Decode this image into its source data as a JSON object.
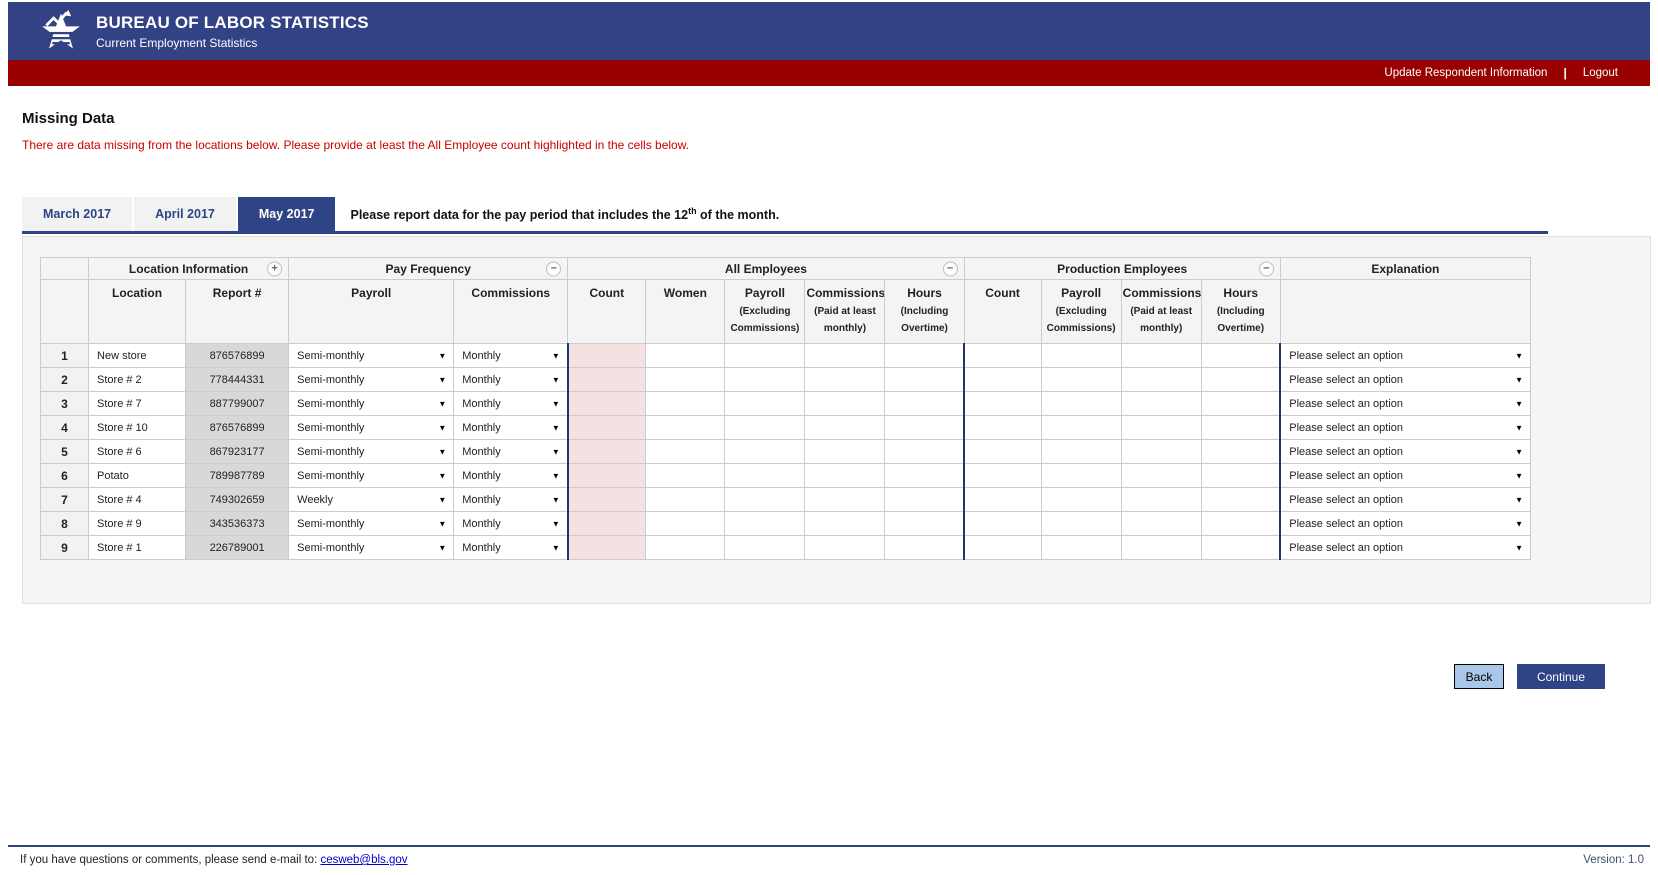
{
  "app": {
    "title": "BUREAU OF LABOR STATISTICS",
    "subtitle": "Current Employment Statistics"
  },
  "nav": {
    "update_respondent": "Update Respondent Information",
    "divider": "|",
    "logout": "Logout"
  },
  "page": {
    "heading": "Missing Data",
    "warning": "There are data missing from the locations below. Please provide at least the All Employee count highlighted in the cells below."
  },
  "tabs": [
    {
      "label": "March 2017",
      "active": false
    },
    {
      "label": "April 2017",
      "active": false
    },
    {
      "label": "May 2017",
      "active": true
    }
  ],
  "instruction": {
    "text_before": "Please report data for the pay period that includes the 12",
    "superscript": "th",
    "text_after": " of the month."
  },
  "table": {
    "groups": {
      "location_information": "Location Information",
      "pay_frequency": "Pay Frequency",
      "all_employees": "All Employees",
      "production_employees": "Production Employees",
      "explanation": "Explanation"
    },
    "icons": {
      "expand": "+",
      "collapse": "−",
      "dropdown": "▼"
    },
    "subheaders": {
      "location": "Location",
      "report": "Report #",
      "payroll": "Payroll",
      "commissions": "Commissions",
      "count": "Count",
      "women": "Women",
      "payroll_excl": [
        "Payroll",
        "(Excluding",
        "Commissions)"
      ],
      "commissions_paid": [
        "Commissions",
        "(Paid at least",
        "monthly)"
      ],
      "hours_incl": [
        "Hours",
        "(Including",
        "Overtime)"
      ]
    },
    "rows": [
      {
        "num": "1",
        "location": "New store",
        "report": "876576899",
        "payroll_frequency": "Semi-monthly",
        "commissions_frequency": "Monthly",
        "explanation": "Please select an option"
      },
      {
        "num": "2",
        "location": "Store # 2",
        "report": "778444331",
        "payroll_frequency": "Semi-monthly",
        "commissions_frequency": "Monthly",
        "explanation": "Please select an option"
      },
      {
        "num": "3",
        "location": "Store # 7",
        "report": "887799007",
        "payroll_frequency": "Semi-monthly",
        "commissions_frequency": "Monthly",
        "explanation": "Please select an option"
      },
      {
        "num": "4",
        "location": "Store # 10",
        "report": "876576899",
        "payroll_frequency": "Semi-monthly",
        "commissions_frequency": "Monthly",
        "explanation": "Please select an option"
      },
      {
        "num": "5",
        "location": "Store # 6",
        "report": "867923177",
        "payroll_frequency": "Semi-monthly",
        "commissions_frequency": "Monthly",
        "explanation": "Please select an option"
      },
      {
        "num": "6",
        "location": "Potato",
        "report": "789987789",
        "payroll_frequency": "Semi-monthly",
        "commissions_frequency": "Monthly",
        "explanation": "Please select an option"
      },
      {
        "num": "7",
        "location": "Store # 4",
        "report": "749302659",
        "payroll_frequency": "Weekly",
        "commissions_frequency": "Monthly",
        "explanation": "Please select an option"
      },
      {
        "num": "8",
        "location": "Store # 9",
        "report": "343536373",
        "payroll_frequency": "Semi-monthly",
        "commissions_frequency": "Monthly",
        "explanation": "Please select an option"
      },
      {
        "num": "9",
        "location": "Store # 1",
        "report": "226789001",
        "payroll_frequency": "Semi-monthly",
        "commissions_frequency": "Monthly",
        "explanation": "Please select an option"
      }
    ]
  },
  "actions": {
    "back": "Back",
    "continue": "Continue"
  },
  "footer": {
    "message": "If you have questions or comments, please send e-mail to: ",
    "email": "cesweb@bls.gov",
    "version": "Version: 1.0"
  },
  "colors": {
    "header_navy": "#324285",
    "bar_red": "#990000",
    "warning_red": "#cc0000",
    "highlight_pink": "#f4e2e2",
    "separator_navy": "#23366b",
    "back_button_blue": "#a9c7e9",
    "continue_button_navy": "#2e4486"
  }
}
